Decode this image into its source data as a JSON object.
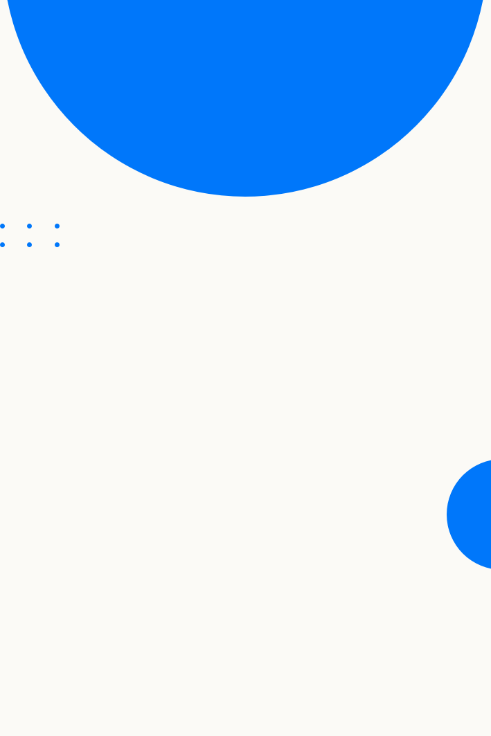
{
  "colors": {
    "background": "#FBFAF6",
    "accent": "#0077FA"
  },
  "shapes": {
    "top_circle": "large-blue-circle",
    "side_circle": "small-blue-half-circle",
    "dot_grid": {
      "rows": 2,
      "columns": 3
    }
  }
}
